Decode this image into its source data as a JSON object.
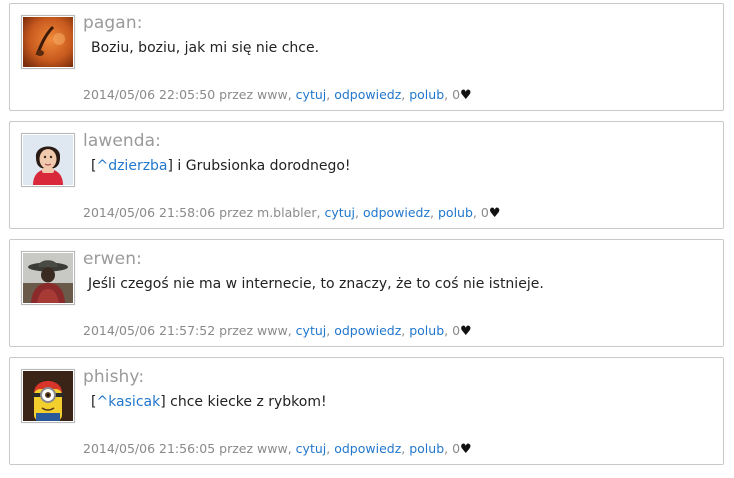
{
  "posts": [
    {
      "author": "pagan:",
      "avatar_icon": "orange-spoon-avatar",
      "text": "Boziu, boziu, jak mi się nie chce.",
      "ref": "",
      "timestamp": "2014/05/06 22:05:50",
      "by_label": "przez",
      "user": "www,",
      "quote": "cytuj",
      "reply": "odpowiedz",
      "like": "polub",
      "likes": "0",
      "heart": "♥"
    },
    {
      "author": "lawenda:",
      "avatar_icon": "girl-red-top-avatar",
      "text": "] i Grubsionka dorodnego!",
      "ref_open": "[",
      "ref": "^dzierzba",
      "timestamp": "2014/05/06 21:58:06",
      "by_label": "przez",
      "user": "m.blabler,",
      "quote": "cytuj",
      "reply": "odpowiedz",
      "like": "polub",
      "likes": "0",
      "heart": "♥"
    },
    {
      "author": "erwen:",
      "avatar_icon": "hat-figure-avatar",
      "text": "Jeśli czegoś nie ma w internecie, to znaczy, że to coś nie istnieje.",
      "ref": "",
      "timestamp": "2014/05/06 21:57:52",
      "by_label": "przez",
      "user": "www,",
      "quote": "cytuj",
      "reply": "odpowiedz",
      "like": "polub",
      "likes": "0",
      "heart": "♥"
    },
    {
      "author": "phishy:",
      "avatar_icon": "minion-red-hat-avatar",
      "text": "] chce kiecke z rybkom!",
      "ref_open": "[",
      "ref": "^kasicak",
      "timestamp": "2014/05/06 21:56:05",
      "by_label": "przez",
      "user": "www,",
      "quote": "cytuj",
      "reply": "odpowiedz",
      "like": "polub",
      "likes": "0",
      "heart": "♥"
    }
  ],
  "colors": {
    "link": "#2277cc",
    "author": "#9a9a9a",
    "meta": "#8a8a8a",
    "border": "#c9c9c9"
  }
}
